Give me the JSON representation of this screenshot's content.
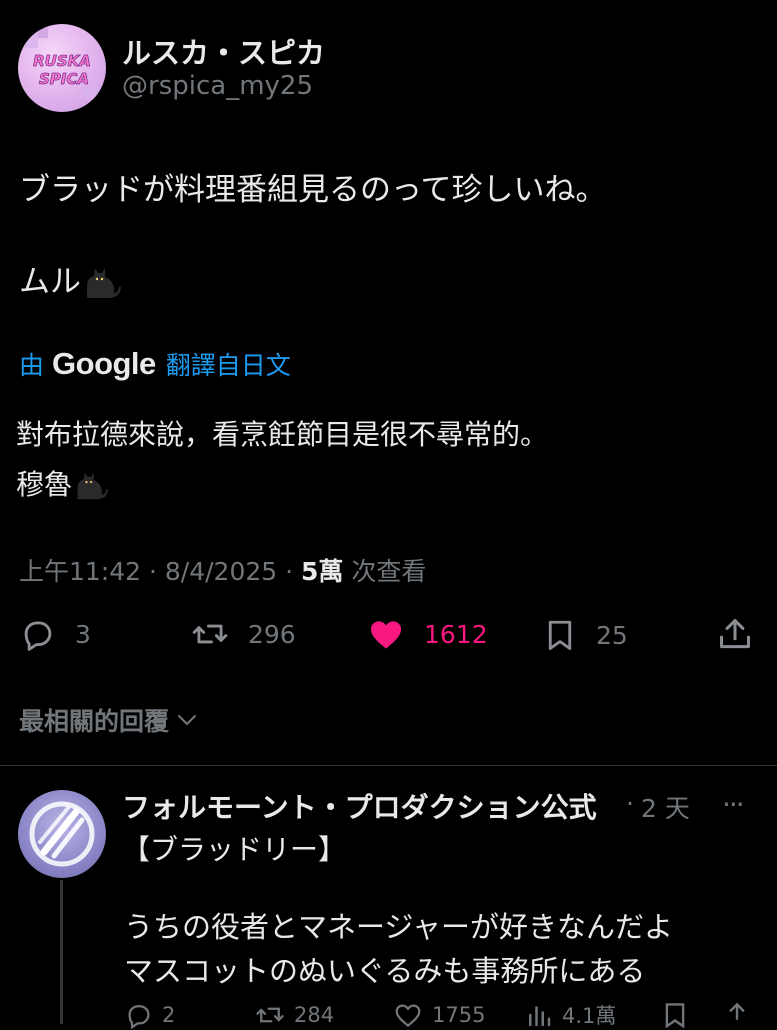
{
  "tweet": {
    "author_name": "ルスカ・スピカ",
    "author_handle": "@rspica_my25",
    "avatar_text_line1": "RUSKA",
    "avatar_text_line2": "SPICA",
    "text_line1": "ブラッドが料理番組見るのって珍しいね。",
    "text_line2": "ムル",
    "translation_prefix": "由",
    "translation_engine": "Google",
    "translation_source": "翻譯自日文",
    "translated_line1": "對布拉德來說，看烹飪節目是很不尋常的。",
    "translated_line2": "穆魯",
    "timestamp": "上午11:42 · 8/4/2025 · ",
    "views_count": "5萬",
    "views_label": " 次查看",
    "replies": "3",
    "reposts": "296",
    "likes": "1612",
    "bookmarks": "25"
  },
  "replies_header": {
    "label": "最相關的回覆"
  },
  "reply": {
    "author_name": "フォルモーント・プロダクション公式",
    "dot": "·",
    "time": "2 天",
    "more": "···",
    "subtitle": "【ブラッドリー】",
    "line1": "うちの役者とマネージャーが好きなんだよ",
    "line2": "マスコットのぬいぐるみも事務所にある",
    "replies": "2",
    "reposts": "284",
    "likes": "1755",
    "views": "4.1萬"
  },
  "colors": {
    "background": "#000000",
    "text_primary": "#e7e9ea",
    "text_secondary": "#71767b",
    "link_blue": "#1d9bf0",
    "like_pink": "#f91880",
    "divider": "#2f3336"
  },
  "icons": {
    "reply": "speech-bubble-icon",
    "repost": "repost-arrows-icon",
    "like": "heart-icon",
    "bookmark": "bookmark-icon",
    "share": "share-upload-icon",
    "views": "bar-chart-icon",
    "chevron": "chevron-down-icon",
    "cat": "black-cat-emoji"
  }
}
